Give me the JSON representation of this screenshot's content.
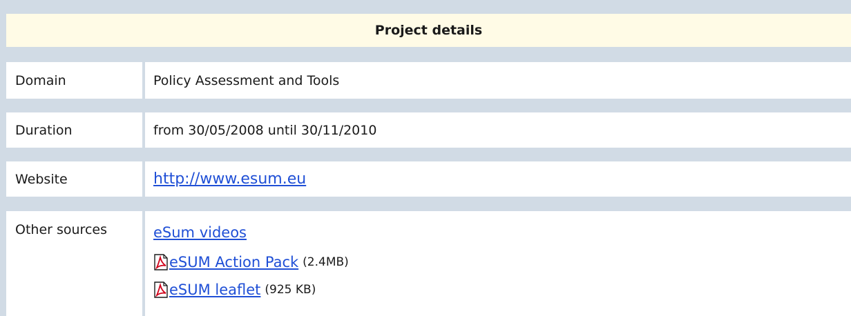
{
  "header": {
    "title": "Project details"
  },
  "rows": {
    "domain": {
      "label": "Domain",
      "value": "Policy Assessment and Tools"
    },
    "duration": {
      "label": "Duration",
      "value": "from 30/05/2008 until 30/11/2010"
    },
    "website": {
      "label": "Website",
      "link_text": "http://www.esum.eu"
    },
    "other_sources": {
      "label": "Other sources",
      "items": [
        {
          "link_text": "eSum videos",
          "icon": "",
          "size": ""
        },
        {
          "link_text": "eSUM Action Pack",
          "icon": "pdf-icon",
          "size": "(2.4MB)"
        },
        {
          "link_text": "eSUM leaflet",
          "icon": "pdf-icon",
          "size": "(925 KB)"
        }
      ]
    }
  },
  "colors": {
    "frame": "#d1dbe5",
    "title_background": "#fffbe6",
    "link": "#1f4fd6",
    "pdf_red": "#d0021b"
  }
}
